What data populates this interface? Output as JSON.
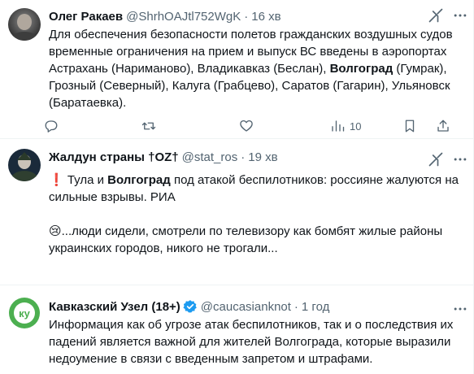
{
  "tweets": [
    {
      "author": "Олег Ракаев",
      "handle": "@ShrhOAJtl752WgK",
      "time": "16 хв",
      "text_parts": [
        "Для обеспечения безопасности полетов гражданских воздушных судов временные ограничения на прием и выпуск ВС введены в аэропортах Астрахань (Нариманово), Владикавказ (Беслан), ",
        "Волгоград",
        " (Гумрак), Грозный (Северный), Калуга (Грабцево), Саратов (Гагарин), Ульяновск (Баратаевка)."
      ],
      "views": "10"
    },
    {
      "author": "Жалдун страны †ОZ†",
      "handle": "@stat_ros",
      "time": "19 хв",
      "text_parts": [
        "❗ Тула и ",
        "Волгоград",
        " под атакой беспилотников: россияне жалуются на сильные взрывы. РИА",
        "😢...люди сидели, смотрели по телевизору как бомбят жилые районы украинских городов, никого не трогали..."
      ],
      "views": ""
    },
    {
      "author": "Кавказский Узел (18+)",
      "handle": "@caucasianknot",
      "time": "1 год",
      "text": "Информация как об угрозе атак беспилотников, так и о последствия их падений является важной для жителей Волгограда, которые выразили недоумение в связи с введенным запретом и штрафами.",
      "verified": true
    }
  ],
  "colors": {
    "text": "#0f1419",
    "secondary": "#536471",
    "verified": "#1d9bf0",
    "divider": "#eff3f4"
  },
  "icons": [
    "reply-icon",
    "retweet-icon",
    "like-icon",
    "views-icon",
    "bookmark-icon",
    "share-icon",
    "grok-icon",
    "more-icon",
    "verified-icon"
  ]
}
